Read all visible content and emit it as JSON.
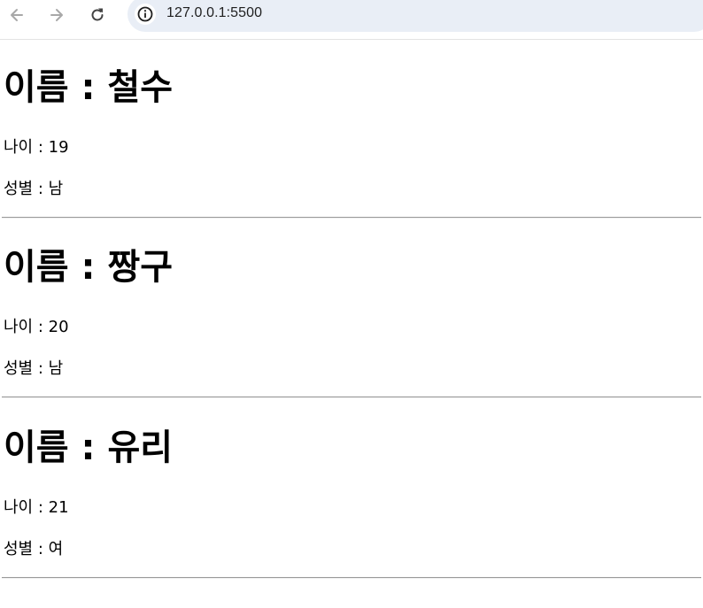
{
  "browser": {
    "url": "127.0.0.1:5500"
  },
  "people": [
    {
      "name": "이름 : 철수",
      "age": "나이 : 19",
      "gender": "성별 : 남"
    },
    {
      "name": "이름 : 짱구",
      "age": "나이 : 20",
      "gender": "성별 : 남"
    },
    {
      "name": "이름 : 유리",
      "age": "나이 : 21",
      "gender": "성별 : 여"
    }
  ],
  "icons": {
    "back": "arrow-left-icon",
    "forward": "arrow-right-icon",
    "reload": "reload-icon",
    "site_info": "info-icon"
  }
}
